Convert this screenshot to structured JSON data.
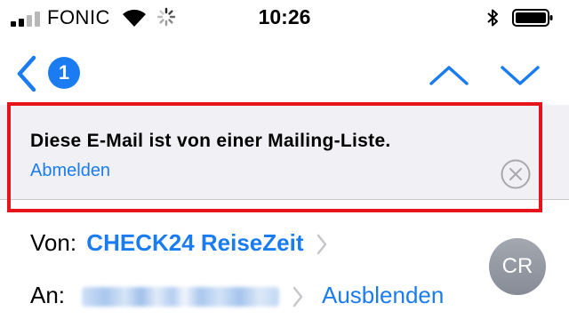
{
  "status_bar": {
    "carrier": "FONIC",
    "time": "10:26"
  },
  "nav": {
    "back_count": "1"
  },
  "banner": {
    "message": "Diese E-Mail ist von einer Mailing-Liste.",
    "unsubscribe_label": "Abmelden"
  },
  "header": {
    "from_label": "Von:",
    "sender_name": "CHECK24 ReiseZeit",
    "to_label": "An:",
    "hide_label": "Ausblenden",
    "avatar_initials": "CR"
  },
  "colors": {
    "accent": "#1a7cf0",
    "highlight_border": "#e6151b",
    "banner_background": "#f0f0f5",
    "avatar": "#8e939c"
  }
}
